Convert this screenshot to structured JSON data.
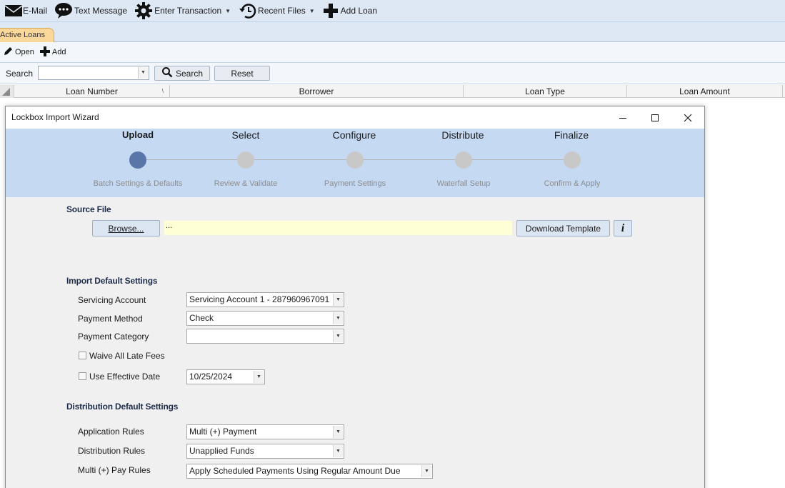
{
  "toolbar": {
    "email": "E-Mail",
    "text_message": "Text Message",
    "enter_transaction": "Enter Transaction",
    "recent_files": "Recent Files",
    "add_loan": "Add Loan"
  },
  "tabs": {
    "active": "Active Loans"
  },
  "subbar": {
    "open": "Open",
    "add": "Add"
  },
  "search": {
    "label": "Search",
    "value": "",
    "search_button": "Search",
    "reset_button": "Reset"
  },
  "grid": {
    "columns": [
      "Loan Number",
      "Borrower",
      "Loan Type",
      "Loan Amount"
    ]
  },
  "dialog": {
    "title": "Lockbox Import Wizard",
    "steps": [
      {
        "title": "Upload",
        "subtitle": "Batch Settings & Defaults",
        "active": true
      },
      {
        "title": "Select",
        "subtitle": "Review & Validate",
        "active": false
      },
      {
        "title": "Configure",
        "subtitle": "Payment Settings",
        "active": false
      },
      {
        "title": "Distribute",
        "subtitle": "Waterfall Setup",
        "active": false
      },
      {
        "title": "Finalize",
        "subtitle": "Confirm & Apply",
        "active": false
      }
    ],
    "source_file": {
      "heading": "Source File",
      "browse_button": "Browse...",
      "file_value": "...",
      "download_button": "Download Template",
      "info_glyph": "i"
    },
    "import_defaults": {
      "heading": "Import Default Settings",
      "servicing_account_label": "Servicing Account",
      "servicing_account_value": "Servicing Account 1  - 287960967091",
      "payment_method_label": "Payment Method",
      "payment_method_value": "Check",
      "payment_category_label": "Payment Category",
      "payment_category_value": "",
      "waive_late_fees_label": "Waive All Late Fees",
      "waive_late_fees_checked": false,
      "use_effective_date_label": "Use Effective Date",
      "use_effective_date_checked": false,
      "effective_date_value": "10/25/2024"
    },
    "distribution_defaults": {
      "heading": "Distribution Default Settings",
      "application_rules_label": "Application Rules",
      "application_rules_value": "Multi (+) Payment",
      "distribution_rules_label": "Distribution Rules",
      "distribution_rules_value": "Unapplied Funds",
      "multi_pay_rules_label": "Multi (+) Pay Rules",
      "multi_pay_rules_value": "Apply Scheduled Payments Using Regular Amount Due"
    }
  },
  "colors": {
    "toolbar_bg": "#dde8f4",
    "active_tab": "#fbd79a",
    "stepper_bg": "#c5d9f3",
    "active_step": "#5a76a8",
    "inactive_step": "#c8c8c8",
    "file_field_bg": "#ffffd6"
  }
}
